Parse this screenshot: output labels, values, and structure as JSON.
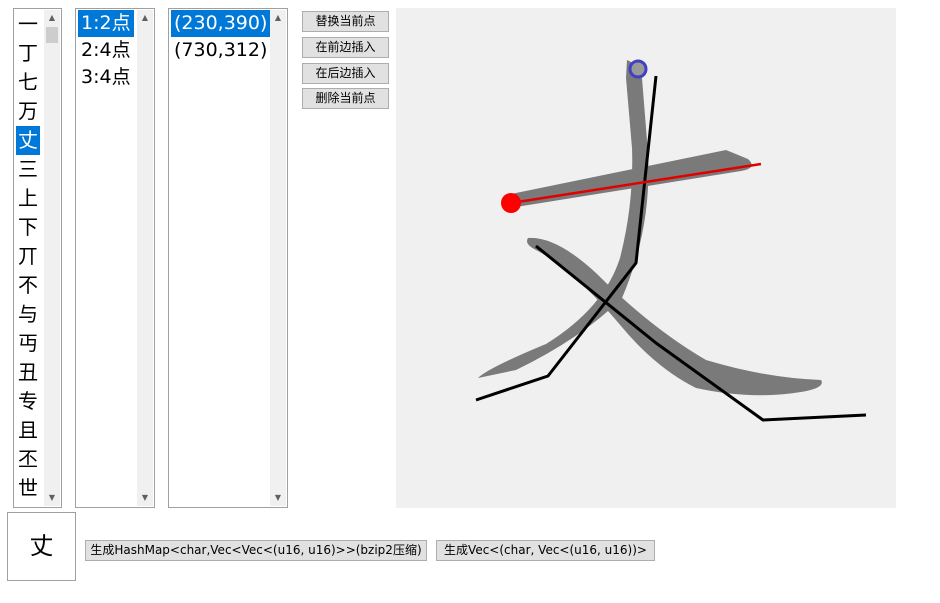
{
  "char_list": {
    "items": [
      "一",
      "丁",
      "七",
      "万",
      "丈",
      "三",
      "上",
      "下",
      "丌",
      "不",
      "与",
      "丏",
      "丑",
      "专",
      "且",
      "丕",
      "世"
    ],
    "selected_index": 4
  },
  "stroke_list": {
    "items": [
      "1:2点",
      "2:4点",
      "3:4点"
    ],
    "selected_index": 0
  },
  "point_list": {
    "items": [
      "(230,390)",
      "(730,312)"
    ],
    "selected_index": 0
  },
  "buttons": {
    "replace": "替换当前点",
    "insert_before": "在前边插入",
    "insert_after": "在后边插入",
    "delete": "删除当前点",
    "gen_hashmap": "生成HashMap<char,Vec<Vec<(u16, u16)>>(bzip2压缩)",
    "gen_vec": "生成Vec<(char, Vec<(u16, u16))>"
  },
  "preview": {
    "char": "丈"
  },
  "colors": {
    "selection": "#0078d7",
    "glyph": "#7a7a7a",
    "active_stroke": "#e00000",
    "stroke": "#000000",
    "point_marker": "#4040c0"
  },
  "icons": {
    "scroll_up": "▲",
    "scroll_down": "▼"
  }
}
